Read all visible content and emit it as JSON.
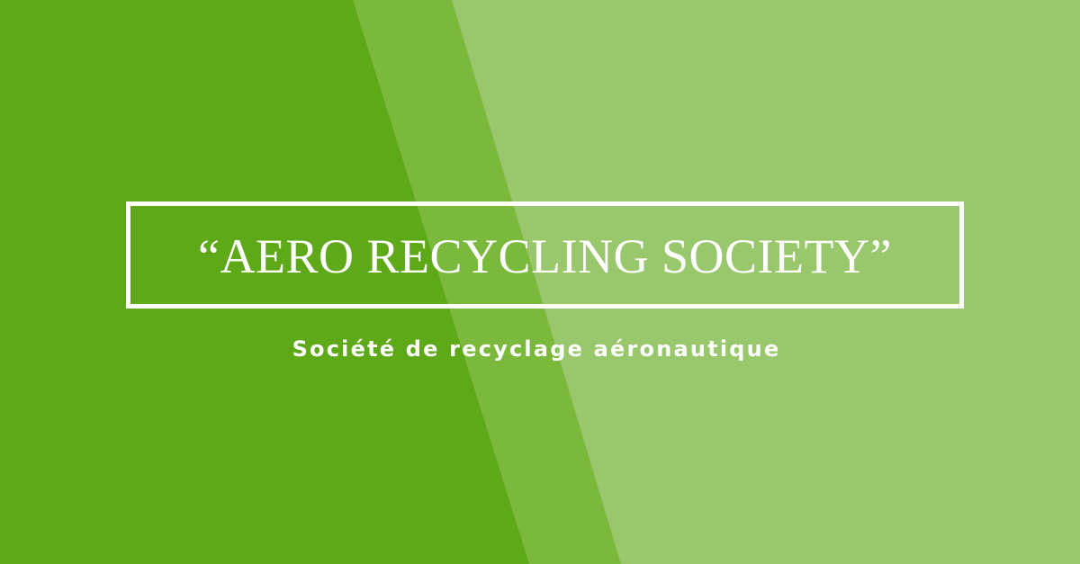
{
  "banner": {
    "title": "“AERO RECYCLING SOCIETY”",
    "subtitle": "Société de recyclage aéronautique"
  },
  "colors": {
    "base_green": "#5ea918",
    "mid_green": "#7ab93c",
    "light_green": "#98c86b",
    "text": "#ffffff"
  }
}
